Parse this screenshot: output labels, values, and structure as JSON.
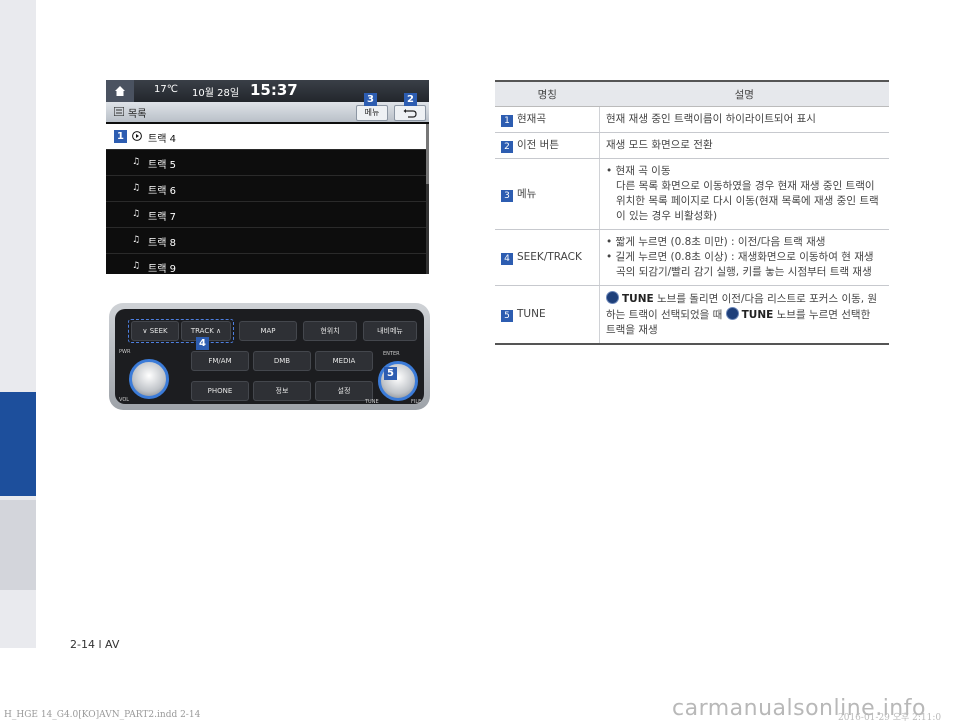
{
  "screen": {
    "temperature": "17℃",
    "date": "10월 28일",
    "time": "15:37",
    "list_title": "목록",
    "menu_button": "메뉴",
    "tracks": [
      {
        "label": "트랙 4",
        "badge": "1",
        "icon": "play-icon"
      },
      {
        "label": "트랙 5",
        "icon": "music-note-icon"
      },
      {
        "label": "트랙 6",
        "icon": "music-note-icon"
      },
      {
        "label": "트랙 7",
        "icon": "music-note-icon"
      },
      {
        "label": "트랙 8",
        "icon": "music-note-icon"
      },
      {
        "label": "트랙 9",
        "icon": "music-note-icon"
      }
    ],
    "badges": {
      "menu": "3",
      "back": "2"
    }
  },
  "panel": {
    "seek": "SEEK",
    "track": "TRACK",
    "map": "MAP",
    "current": "현위치",
    "navi_menu": "내비메뉴",
    "fm_am": "FM/AM",
    "dmb": "DMB",
    "media": "MEDIA",
    "phone": "PHONE",
    "info": "정보",
    "settings": "설정",
    "vol": "VOL",
    "tune": "TUNE",
    "file": "FILE",
    "enter": "ENTER",
    "pwr": "PWR",
    "badge_seek": "4",
    "badge_tune": "5"
  },
  "table": {
    "header_name": "명칭",
    "header_desc": "설명",
    "rows": [
      {
        "num": "1",
        "name": "현재곡",
        "desc": "현재 재생 중인 트랙이름이 하이라이트되어 표시"
      },
      {
        "num": "2",
        "name": "이전 버튼",
        "desc": "재생 모드 화면으로 전환"
      },
      {
        "num": "3",
        "name": "메뉴",
        "b1": "현재 곡 이동",
        "b1_sub": "다른 목록 화면으로 이동하였을 경우 현재 재생 중인 트랙이 위치한 목록 페이지로 다시 이동(현재 목록에 재생 중인 트랙이 있는 경우 비활성화)"
      },
      {
        "num": "4",
        "name": "SEEK/TRACK",
        "b1": "짧게 누르면 (0.8초 미만) : 이전/다음 트랙 재생",
        "b2": "길게 누르면 (0.8초 이상) : 재생화면으로 이동하여 현 재생곡의 되감기/빨리 감기 실행, 키를 놓는 시점부터 트랙 재생"
      },
      {
        "num": "5",
        "name": "TUNE",
        "tune1": "TUNE",
        "d1": " 노브를 돌리면 이전/다음 리스트로 포커스 이동, 원하는 트랙이 선택되었을 때 ",
        "tune2": "TUNE",
        "d2": " 노브를 누르면 선택한 트랙을 재생"
      }
    ]
  },
  "page_number": "2-14 l AV",
  "footer_left": "H_HGE 14_G4.0[KO]AVN_PART2.indd   2-14",
  "footer_right": "2016-01-29   오후 2:11:0",
  "watermark": "carmanualsonline.info"
}
